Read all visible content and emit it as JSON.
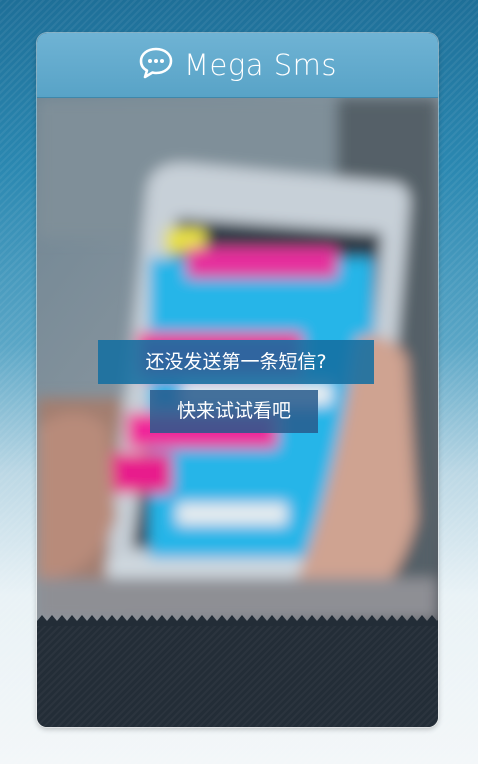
{
  "app": {
    "title": "Mega Sms",
    "logo_icon": "chat-bubble-icon"
  },
  "empty_state": {
    "message": "还没发送第一条短信?",
    "action_label": "快来试试看吧"
  },
  "colors": {
    "header": "#5fa9cc",
    "message_bg": "#146ea0",
    "footer": "#232d37"
  }
}
